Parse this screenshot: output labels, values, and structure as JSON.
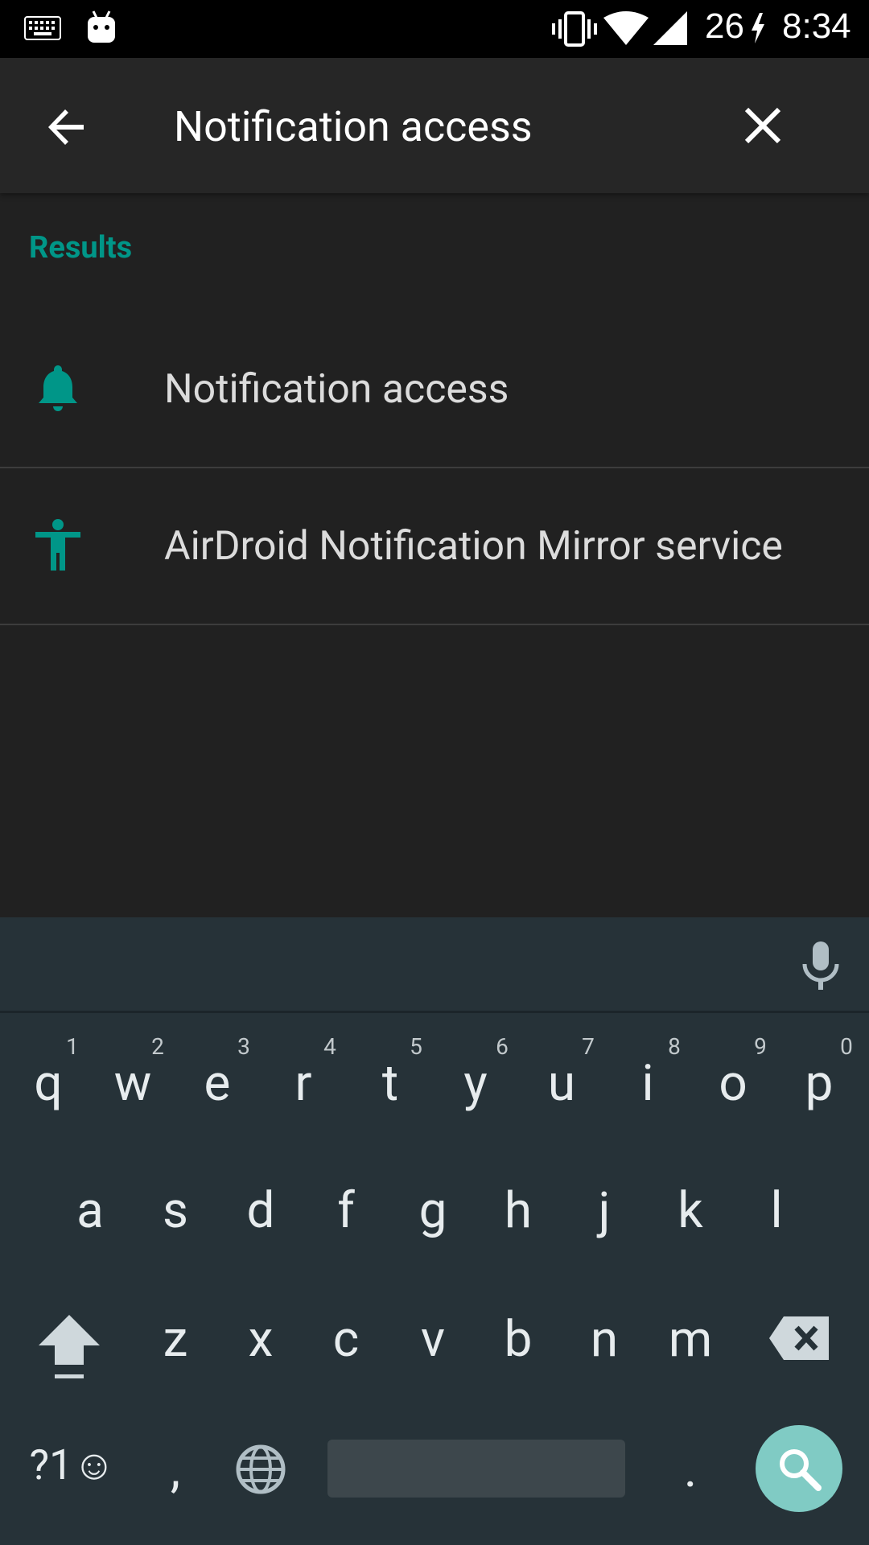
{
  "status_bar": {
    "battery_level": "26",
    "time": "8:34",
    "icons": [
      "keyboard-icon",
      "android-debug-icon",
      "vibrate-icon",
      "wifi-icon",
      "cellular-signal-icon",
      "charging-icon"
    ]
  },
  "toolbar": {
    "search_query": "Notification access"
  },
  "results": {
    "header": "Results",
    "items": [
      {
        "icon": "bell-icon",
        "label": "Notification access"
      },
      {
        "icon": "accessibility-icon",
        "label": "AirDroid Notification Mirror service"
      }
    ]
  },
  "keyboard": {
    "row1": [
      "q",
      "w",
      "e",
      "r",
      "t",
      "y",
      "u",
      "i",
      "o",
      "p"
    ],
    "row1_hints": [
      "1",
      "2",
      "3",
      "4",
      "5",
      "6",
      "7",
      "8",
      "9",
      "0"
    ],
    "row2": [
      "a",
      "s",
      "d",
      "f",
      "g",
      "h",
      "j",
      "k",
      "l"
    ],
    "row3": [
      "z",
      "x",
      "c",
      "v",
      "b",
      "n",
      "m"
    ],
    "symbols_key": "?1☺",
    "comma_key": ",",
    "period_key": "."
  },
  "colors": {
    "accent": "#009688",
    "background": "#212121",
    "keyboard_bg": "#263238",
    "search_fab": "#80cbc4"
  }
}
